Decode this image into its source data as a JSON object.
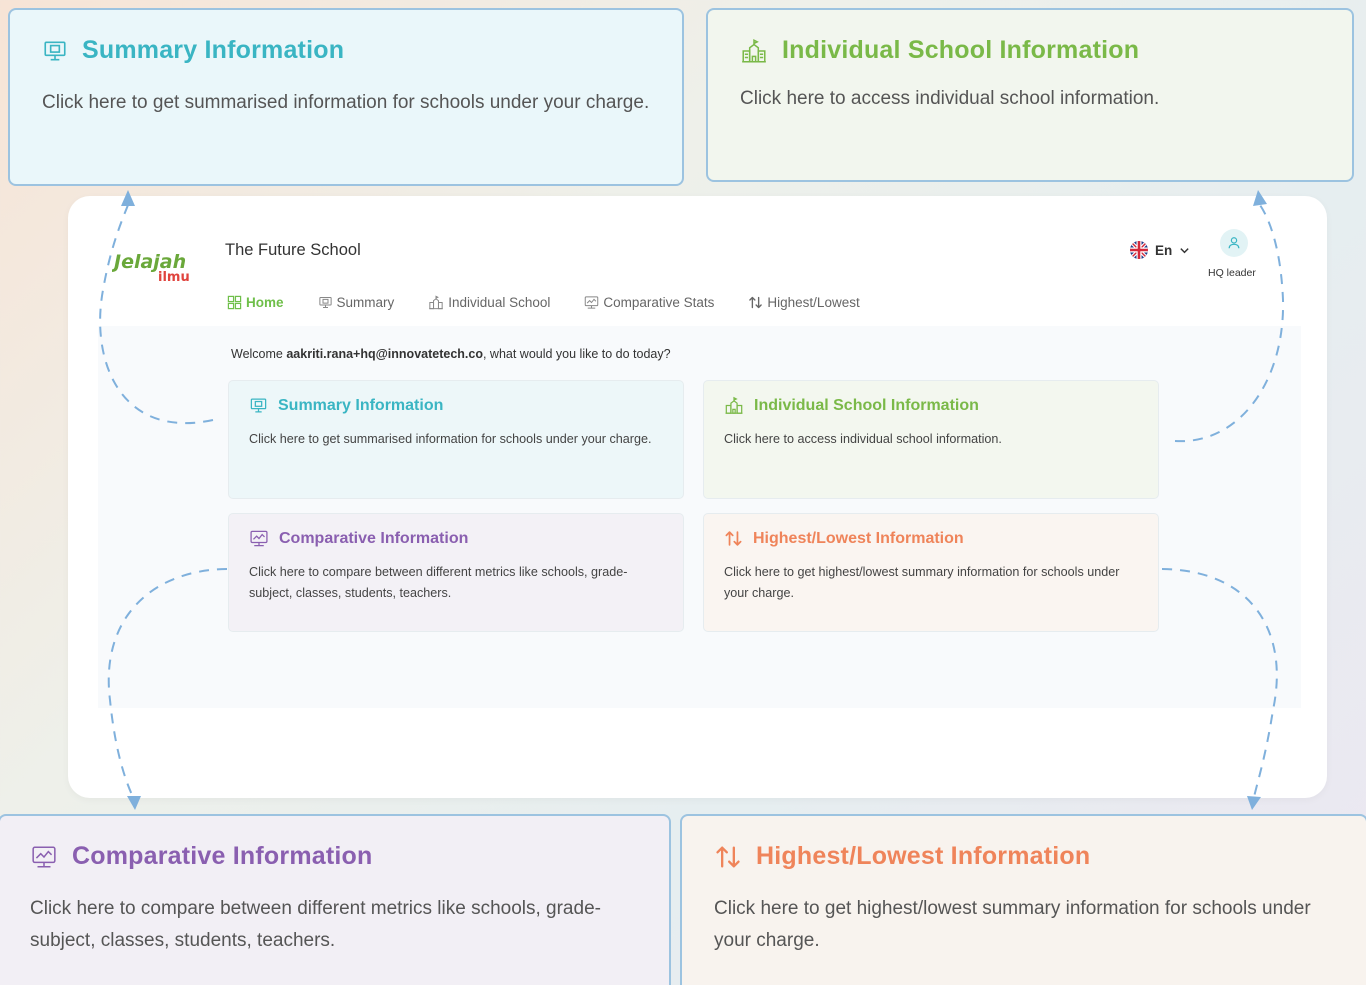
{
  "callouts": {
    "summary": {
      "title": "Summary Information",
      "desc": "Click here to get summarised information for schools under your charge."
    },
    "individual": {
      "title": "Individual School Information",
      "desc": "Click here to access individual school information."
    },
    "comparative": {
      "title": "Comparative Information",
      "desc": "Click here to compare between different metrics like schools, grade-subject, classes, students, teachers."
    },
    "highlow": {
      "title": "Highest/Lowest Information",
      "desc": "Click here to get highest/lowest summary information for schools under your charge."
    }
  },
  "app": {
    "logo": {
      "line1": "Jelajah",
      "line2": "ilmu"
    },
    "school_name": "The Future School",
    "language": "En",
    "user_role": "HQ leader",
    "nav": [
      {
        "label": "Home",
        "icon": "grid-icon"
      },
      {
        "label": "Summary",
        "icon": "presentation-icon"
      },
      {
        "label": "Individual School",
        "icon": "school-icon"
      },
      {
        "label": "Comparative Stats",
        "icon": "chart-monitor-icon"
      },
      {
        "label": "Highest/Lowest",
        "icon": "sort-arrows-icon"
      }
    ],
    "welcome": {
      "prefix": "Welcome ",
      "email": "aakriti.rana+hq@innovatetech.co",
      "suffix": ", what would you like to do today?"
    },
    "cards": {
      "summary": {
        "title": "Summary Information",
        "desc": "Click here to get summarised information for schools under your charge."
      },
      "individual": {
        "title": "Individual School Information",
        "desc": "Click here to access individual school information."
      },
      "comparative": {
        "title": "Comparative Information",
        "desc": "Click here to compare between different metrics like schools, grade-subject, classes, students, teachers."
      },
      "highlow": {
        "title": "Highest/Lowest Information",
        "desc": "Click here to get highest/lowest summary information for schools under your charge."
      }
    }
  },
  "colors": {
    "summary": "#3ab5c3",
    "individual": "#7ab948",
    "comparative": "#8a5fb0",
    "highlow": "#ef845a",
    "connector": "#7fb0dc"
  }
}
